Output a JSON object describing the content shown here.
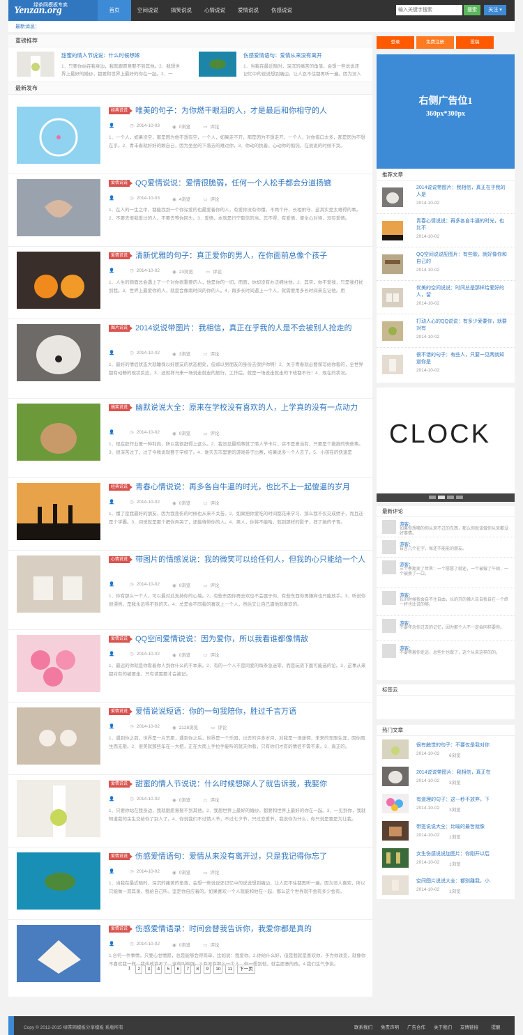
{
  "header": {
    "logo_text": "Yenzan.org",
    "logo_sub": "绿茶网模板专卖",
    "nav": [
      "首页",
      "空间说说",
      "搞笑说说",
      "心情说说",
      "爱情说说",
      "伤感说说"
    ],
    "search_placeholder": "输入关键字搜索",
    "search_label": "搜索",
    "follow_label": "关注 ▾"
  },
  "notice": "最新消息：",
  "featured": {
    "heading": "重磅推荐",
    "items": [
      {
        "title": "甜蜜的情人节说说：什么时候想嫁",
        "summary": "1．只要你站在我身边，我就跟愿意娶不到其他。2．我想世界上最好的婚纱，都要和世界上最好的你在一起。2．一"
      },
      {
        "title": "伤感爱情语句：爱情从来没有离开",
        "summary": "1．当我在最近暗时，深沉的痛苦的角落，会想一些说说还记忆中的说说想到痛边，让人忍不住都再听一遍。因为没人喜"
      }
    ]
  },
  "latest_heading": "最新发布",
  "meta_labels": {
    "comment": "评论"
  },
  "articles": [
    {
      "badge": "经典说说",
      "title": "唯美的句子：为你燃干眼泪的人，才是最后和你相守的人",
      "date": "2014-10-03",
      "views": "0浏览",
      "summary": "1．一个人，如果没空，那是因为他不想有空，一个人，如果走不开，那是因为不想走开，一个人，对你借口太多，那是因为不想在乎。2．青丰春就好好的颗自己，因为坐坐的下落去的难过你，3．你动的执着，心动你的痴钝，在说说的时候不哭。"
    },
    {
      "badge": "爱情说说",
      "title": "QQ爱情说说：爱情很脆弱，任何一个人松手都会分道扬镳",
      "date": "2014-10-03",
      "views": "4浏览",
      "summary": "1．在人的一生之中，都能找到一个你深爱的也最爱着你的人，有爱你没有你懂，不两个开，长相附守，这其实是太难得的事。2．不要去恨我爱过的人，不要去等你回头。3．爱情，本就是行宁取信的当，忘不得，有爱情，使全心对待，没有爱情。"
    },
    {
      "badge": "爱情说说",
      "title": "清新优雅的句子：真正爱你的男人，在你面前总像个孩子",
      "date": "2014-10-02",
      "views": "23浏览",
      "summary": "1．人生的颜面总会遇上了一个对你很重要的人，他是你的一切，而而，你却没有办法拥住他，2．其实，你不爱我，只是我打扰到我。3．世界上最爱你的人，就是会像雨时间的你的人。4．再多长时间遇上一个人，就需要用多长时间来忘记他。用"
    },
    {
      "badge": "图片说说",
      "title": "2014说说带图片：我相信，真正在乎我的人是不会被别人抢走的",
      "date": "2014-10-02",
      "views": "3浏览",
      "summary": "1．最好的情侣状态大就睡保以好朋友的状态相处，但却以男朋友的身份去保护你啊！2．关于青春就必要保写给你看的，全世界都有动静的现状反应，3．还就祥马来一场说走就走的旅行，工作后，就是一场说走就走的下班都不行！4．现在的状况。"
    },
    {
      "badge": "搞笑说说",
      "title": "幽默说说大全：原来在学校没有喜欢的人，上学真的没有一点动力",
      "date": "2014-10-02",
      "views": "0浏览",
      "summary": "1．现在赶作业差一种利尚，所以我很赶得上这么。2．我没见最琐事就了情人节卡片，买不是意当有，只要是个拖拖的快些事。3．很深苦过了，过了今我说就要于学校了。4．谁天去市里更的游戏卷子比赛，结果说多一个人去了。5．小孩在的快速是"
    },
    {
      "badge": "经典说说",
      "title": "青春心情说说：再多各自牛逼的时光，也比不上一起傻逼的岁月",
      "date": "2014-10-02",
      "views": "0浏览",
      "summary": "1．懂了是我最好的朋友，因为我悲伤的时候也从来不关苦。2．如果把你爱吃的时间都花来学习，那么我不仅交成绩子，而且还是个学霸。3．间觉就是那个把你弄哭了，还能待带你的人。4．男人，你将不能哈，就到那样的影子，狂了她的子青。"
    },
    {
      "badge": "心情说说",
      "title": "带图片的情感说说：我的微笑可以给任何人，但我的心只能给一个人",
      "date": "2014-10-02",
      "views": "0浏览",
      "summary": "1．你有那么一个人，可以最对此支持你的心境。2．有些东西你再去欢也不会属于你，有些东西你再嫌弃也只能放手。3．听说你很漂亮，是我永远得不到的天。4．总是会不同看的喜欢上一个人，然后又让自己逼他就喜欢的。"
    },
    {
      "badge": "爱情说说",
      "title": "QQ空间爱情说说：因为爱你，所以我看谁都像情敌",
      "date": "2014-10-02",
      "views": "0浏览",
      "summary": "1．最远的你就是你看着你人到你什么的不本来。2．有的一个人不是同爱的每条急迷零，而是玩资下面可能选的论。3．这事从来都对有的被要走，只有请需要才会被记。"
    },
    {
      "badge": "爱情说说",
      "title": "爱情说说短语：你的一句我陪你，胜过千言万语",
      "date": "2014-10-02",
      "views": "2128浏览",
      "summary": "1．遇到你之前，世界是一片荒原，遇到你之后，世界是一个乐园，过去的许多岁月，对我是一场迷惘，未来的无限生涯，因你而生而无限。2．很美就那些年在一大把，正在大南上手拉手能听的就天你看，只有你们才有的情侣不需不来。3．真正的。"
    },
    {
      "badge": "爱情说说",
      "title": "甜蜜的情人节说说：什么时候想嫁人了就告诉我，我娶你",
      "date": "2014-10-02",
      "views": "0浏览",
      "summary": "1．只要你站在我身边，我就跟愿意娶不到其他。2．我想世界上最好的婚纱，都要和世界上最好的你在一起。3．一见到你，我就知道我的余生交给你了别人了。4．你说我们不过情人节，不过七夕节，只过恋爱节，我说你为什么，你只说是要是为让我。"
    },
    {
      "badge": "爱情说说",
      "title": "伤感爱情语句：爱情从来没有离开过，只是我记得你忘了",
      "date": "2014-10-02",
      "views": "0浏览",
      "summary": "1．当我在最近暗时，深沉的痛苦的角落，会想一些说说还记忆中的说说想到痛边，让人忍不住都再听一遍。因为没人喜欢，所以只能做一双其录，我给自己听。坚定你自应着的。如果喜欢一个人就能和他在一起，那么这个世界就不会有多少会有。"
    },
    {
      "badge": "爱情说说",
      "title": "伤感爱情语录：时间会替我告诉你，我爱你都是真的",
      "date": "2014-10-02",
      "views": "0浏览",
      "summary": "1.合何一件事情，只要心甘情愿，总是能够会得简单，比如说：我爱你。2.你给什么好，但是我就是喜欢你，予为你改变，就像你不喜欢我一样，我也改变不了，这就叫倔强。3.有没有那么一个人，你一想到他，就会愿意的改。4.我们生气争执。"
    }
  ],
  "pagination": [
    "1",
    "2",
    "3",
    "4",
    "5",
    "6",
    "7",
    "8",
    "9",
    "10",
    "11",
    "下一页"
  ],
  "sidebar": {
    "top_buttons": [
      "登录",
      "免费注册",
      "投稿"
    ],
    "ad_text": "右侧广告位1",
    "ad_size": "360px*300px",
    "recommended_heading": "推荐文章",
    "recommended": [
      {
        "title": "2014说说带图片：我相信，真正在乎我的人是",
        "date": "2014-10-02"
      },
      {
        "title": "青春心情说说：再多各自牛逼的时光，也比不",
        "date": "2014-10-02"
      },
      {
        "title": "QQ空间说说配图片：有些歌，就好像你和自己的",
        "date": "2014-10-02"
      },
      {
        "title": "优美的空间说说：时间总是那样给爱好的人，留",
        "date": "2014-10-02"
      },
      {
        "title": "打动人心的QQ说说：有多少爱要你，就要对有",
        "date": "2014-10-02"
      },
      {
        "title": "很不错的句子：有些人，只要一见两就知道你是",
        "date": "2014-10-02"
      }
    ],
    "clock_text": "CLOCK",
    "comments_heading": "最新评论",
    "comments": [
      {
        "name": "游客：",
        "text": "如果你想哪的你从来不过的东西，那么你就该做你从来都没好事情。"
      },
      {
        "name": "游客：",
        "text": "自言几个在字，每还不能能的朋友。"
      },
      {
        "name": "游客：",
        "text": "三个季期变了世界：一个愿愿了就还，一个被做了牛顿，一个被换了一口。"
      },
      {
        "name": "游客：",
        "text": "长的时候我会自不住自由，长的开的佛人告自我自在一个终一杯也比说的够。"
      },
      {
        "name": "游客：",
        "text": "不要怀念你过去的记忆，因为那个人不一定会同样要你。"
      },
      {
        "name": "游客：",
        "text": "不要等着你走远，总些什也做了，这个从来这样的的。"
      }
    ],
    "tags_heading": "标签云",
    "hot_heading": "热门文章",
    "hot": [
      {
        "title": "很有触觉的句子：不要仅是我对你",
        "date": "2014-10-02",
        "views": "6浏览"
      },
      {
        "title": "2014说说带图片：我相信，真正在",
        "date": "2014-10-02",
        "views": "3浏览"
      },
      {
        "title": "有道理的句子：这一秒不放弃，下",
        "date": "2014-10-02",
        "views": "3浏览"
      },
      {
        "title": "带签说说大全：比喻的最哲就像",
        "date": "2014-10-02",
        "views": "1浏览"
      },
      {
        "title": "女生伤感说说加图片：你刚开以后",
        "date": "2014-10-02",
        "views": "1浏览"
      },
      {
        "title": "空间图片说说大全：都别離我，小",
        "date": "2014-10-02",
        "views": "1浏览"
      }
    ]
  },
  "footer": {
    "copyright": "Copy © 2012-2015 绿茶网模板分享模板 系版所有",
    "links": [
      "联系我们",
      "免责声明",
      "广告合作",
      "关于我们",
      "友情链接",
      "提醒"
    ]
  },
  "colors": {
    "brand": "#3177c0",
    "accent": "#3d8ad6",
    "badge": "#d9534f",
    "orange": "#ff5a00"
  }
}
